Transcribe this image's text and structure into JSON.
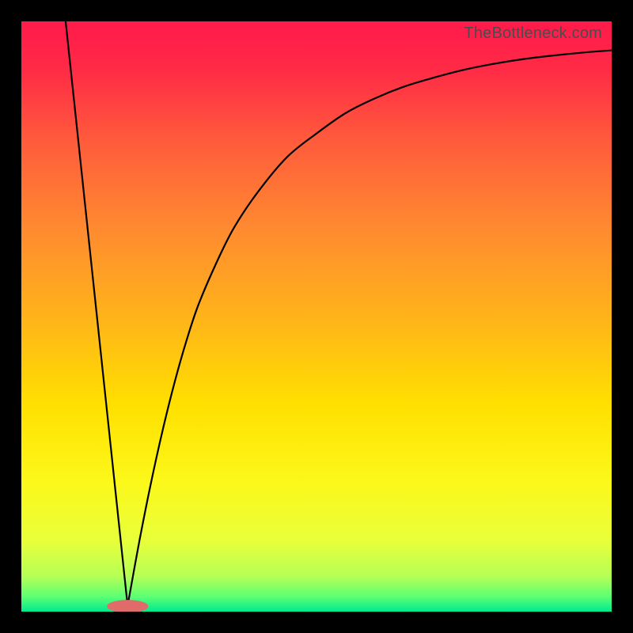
{
  "watermark": "TheBottleneck.com",
  "chart_data": {
    "type": "line",
    "title": "",
    "xlabel": "",
    "ylabel": "",
    "xlim": [
      0,
      100
    ],
    "ylim": [
      0,
      100
    ],
    "background_gradient": {
      "type": "vertical",
      "stops": [
        {
          "pos": 0.0,
          "color": "#ff1a4b"
        },
        {
          "pos": 0.08,
          "color": "#ff2a46"
        },
        {
          "pos": 0.2,
          "color": "#ff5a3c"
        },
        {
          "pos": 0.35,
          "color": "#ff8a30"
        },
        {
          "pos": 0.5,
          "color": "#ffb31a"
        },
        {
          "pos": 0.65,
          "color": "#ffe000"
        },
        {
          "pos": 0.78,
          "color": "#fcf81a"
        },
        {
          "pos": 0.88,
          "color": "#e8ff3a"
        },
        {
          "pos": 0.94,
          "color": "#b6ff55"
        },
        {
          "pos": 0.975,
          "color": "#5bff74"
        },
        {
          "pos": 1.0,
          "color": "#00e98f"
        }
      ]
    },
    "vertex_x": 18,
    "series": [
      {
        "name": "left-branch",
        "type": "line",
        "color": "#000000",
        "x": [
          7.5,
          18
        ],
        "y": [
          100,
          1
        ]
      },
      {
        "name": "right-branch",
        "type": "curve",
        "color": "#000000",
        "x": [
          18,
          20,
          22,
          24,
          26,
          28,
          30,
          33,
          36,
          40,
          45,
          50,
          55,
          60,
          65,
          70,
          75,
          80,
          85,
          90,
          95,
          100
        ],
        "y": [
          1,
          12,
          22,
          31,
          39,
          46,
          52,
          59,
          65,
          71,
          77,
          81,
          84.5,
          87,
          89,
          90.5,
          91.8,
          92.8,
          93.6,
          94.2,
          94.7,
          95.1
        ]
      }
    ],
    "marker": {
      "color": "#e06b6b",
      "cx": 18,
      "cy": 0.9,
      "rx": 3.5,
      "ry": 1.1
    }
  }
}
